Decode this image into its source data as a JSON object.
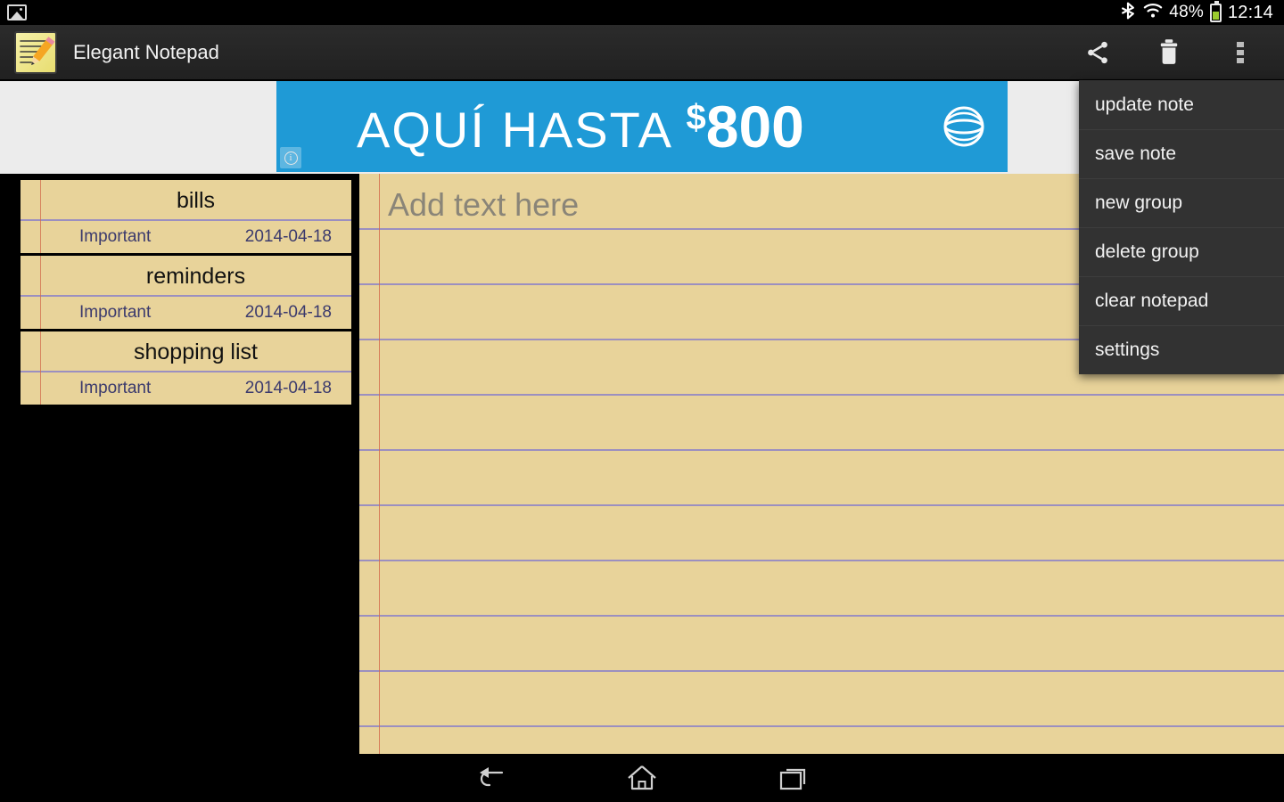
{
  "status_bar": {
    "notification_icon": "image-icon",
    "bluetooth_icon": "bluetooth-icon",
    "wifi_icon": "wifi-icon",
    "battery_percent": "48%",
    "battery_level": 48,
    "clock": "12:14"
  },
  "action_bar": {
    "app_icon": "notepad-pencil-icon",
    "title": "Elegant Notepad",
    "icons": [
      {
        "name": "share-icon",
        "label": "share"
      },
      {
        "name": "delete-icon",
        "label": "delete"
      },
      {
        "name": "overflow-menu-icon",
        "label": "more options"
      }
    ]
  },
  "ad": {
    "headline": "AQUÍ HASTA ",
    "currency": "$",
    "amount": "800",
    "brand_icon": "att-globe-icon",
    "info_badge": "i",
    "background_color": "#1f9ad6"
  },
  "note_list": {
    "items": [
      {
        "title": "bills",
        "tag": "Important",
        "date": "2014-04-18"
      },
      {
        "title": "reminders",
        "tag": "Important",
        "date": "2014-04-18"
      },
      {
        "title": "shopping  list",
        "tag": "Important",
        "date": "2014-04-18"
      }
    ]
  },
  "editor": {
    "placeholder": "Add text here",
    "value": "",
    "paper_color": "#e8d39a",
    "rule_color": "#9b8fc0",
    "margin_color": "#d2694a"
  },
  "overflow_menu": {
    "items": [
      {
        "label": "update note"
      },
      {
        "label": "save note"
      },
      {
        "label": "new group"
      },
      {
        "label": "delete group"
      },
      {
        "label": "clear notepad"
      },
      {
        "label": "settings"
      }
    ]
  },
  "nav_bar": {
    "buttons": [
      {
        "name": "back-button",
        "icon": "back-icon"
      },
      {
        "name": "home-button",
        "icon": "home-icon"
      },
      {
        "name": "recents-button",
        "icon": "recents-icon"
      }
    ]
  }
}
